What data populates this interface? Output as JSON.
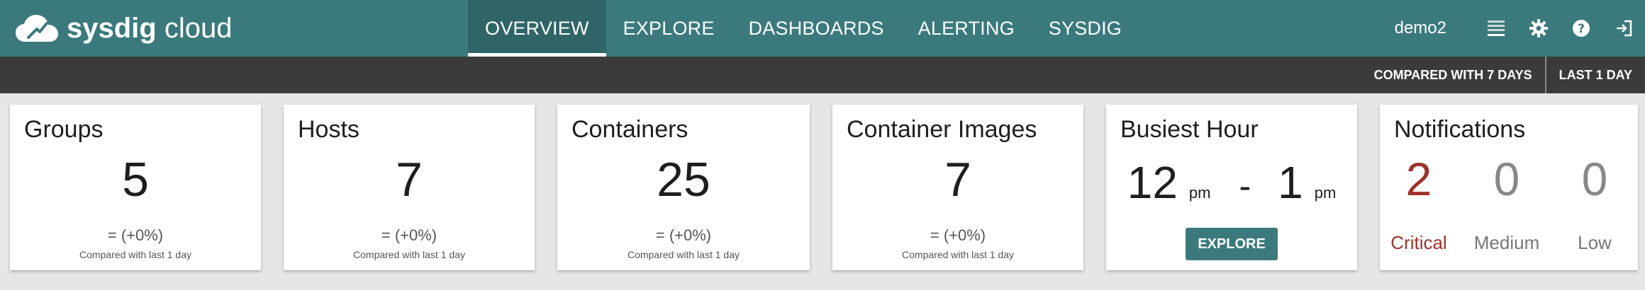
{
  "app": {
    "logo_bold": "sysdig",
    "logo_light": "cloud"
  },
  "nav": {
    "items": [
      {
        "label": "OVERVIEW",
        "active": true
      },
      {
        "label": "EXPLORE",
        "active": false
      },
      {
        "label": "DASHBOARDS",
        "active": false
      },
      {
        "label": "ALERTING",
        "active": false
      },
      {
        "label": "SYSDIG",
        "active": false
      }
    ]
  },
  "header": {
    "user": "demo2",
    "icons": [
      "menu-icon",
      "gear-icon",
      "help-icon",
      "logout-icon"
    ]
  },
  "subbar": {
    "compare_label": "COMPARED WITH 7 DAYS",
    "range_label": "LAST 1 DAY"
  },
  "cards": {
    "groups": {
      "title": "Groups",
      "value": "5",
      "change": "= (+0%)",
      "compared": "Compared with last 1 day"
    },
    "hosts": {
      "title": "Hosts",
      "value": "7",
      "change": "= (+0%)",
      "compared": "Compared with last 1 day"
    },
    "containers": {
      "title": "Containers",
      "value": "25",
      "change": "= (+0%)",
      "compared": "Compared with last 1 day"
    },
    "images": {
      "title": "Container Images",
      "value": "7",
      "change": "= (+0%)",
      "compared": "Compared with last 1 day"
    },
    "busiest": {
      "title": "Busiest Hour",
      "start": "12",
      "start_suffix": "pm",
      "dash": "-",
      "end": "1",
      "end_suffix": "pm",
      "button": "EXPLORE"
    },
    "notifications": {
      "title": "Notifications",
      "critical": {
        "value": "2",
        "label": "Critical"
      },
      "medium": {
        "value": "0",
        "label": "Medium"
      },
      "low": {
        "value": "0",
        "label": "Low"
      }
    }
  },
  "colors": {
    "header": "#3a7a7c",
    "subbar": "#3b3b3b",
    "critical": "#a0302a"
  }
}
